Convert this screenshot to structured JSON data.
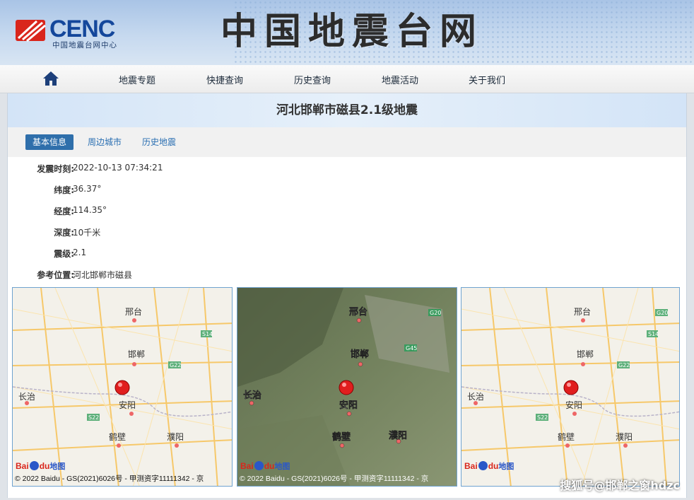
{
  "header": {
    "logo_text": "CENC",
    "logo_subtitle": "中国地震台网中心",
    "site_title": "中国地震台网"
  },
  "nav": {
    "home_icon": "home-icon",
    "items": [
      "地震专题",
      "快捷查询",
      "历史查询",
      "地震活动",
      "关于我们"
    ]
  },
  "quake": {
    "title": "河北邯郸市磁县2.1级地震"
  },
  "tabs": [
    "基本信息",
    "周边城市",
    "历史地震"
  ],
  "info": [
    {
      "label": "发震时刻:",
      "value": "2022-10-13 07:34:21"
    },
    {
      "label": "纬度:",
      "value": "36.37°"
    },
    {
      "label": "经度:",
      "value": "114.35°"
    },
    {
      "label": "深度:",
      "value": "10千米"
    },
    {
      "label": "震级:",
      "value": "2.1"
    },
    {
      "label": "参考位置:",
      "value": "河北邯郸市磁县"
    }
  ],
  "maps": {
    "copyright": "© 2022 Baidu - GS(2021)6026号 - 甲测资字11111342 - 京",
    "baidu_logo": "Bai",
    "baidu_logo_du": "du",
    "baidu_map_label": "地图",
    "cities": [
      "邢台",
      "邯郸",
      "长治",
      "安阳",
      "鹤壁",
      "濮阳"
    ],
    "highways": [
      "S14",
      "G22",
      "S22",
      "G20",
      "G45"
    ]
  },
  "watermark": "搜狐号@邯郸之窗hdzc",
  "colors": {
    "accent": "#2f6fab",
    "epicenter": "#e01e1e",
    "logo_blue": "#14479b",
    "logo_red": "#d9261c"
  }
}
